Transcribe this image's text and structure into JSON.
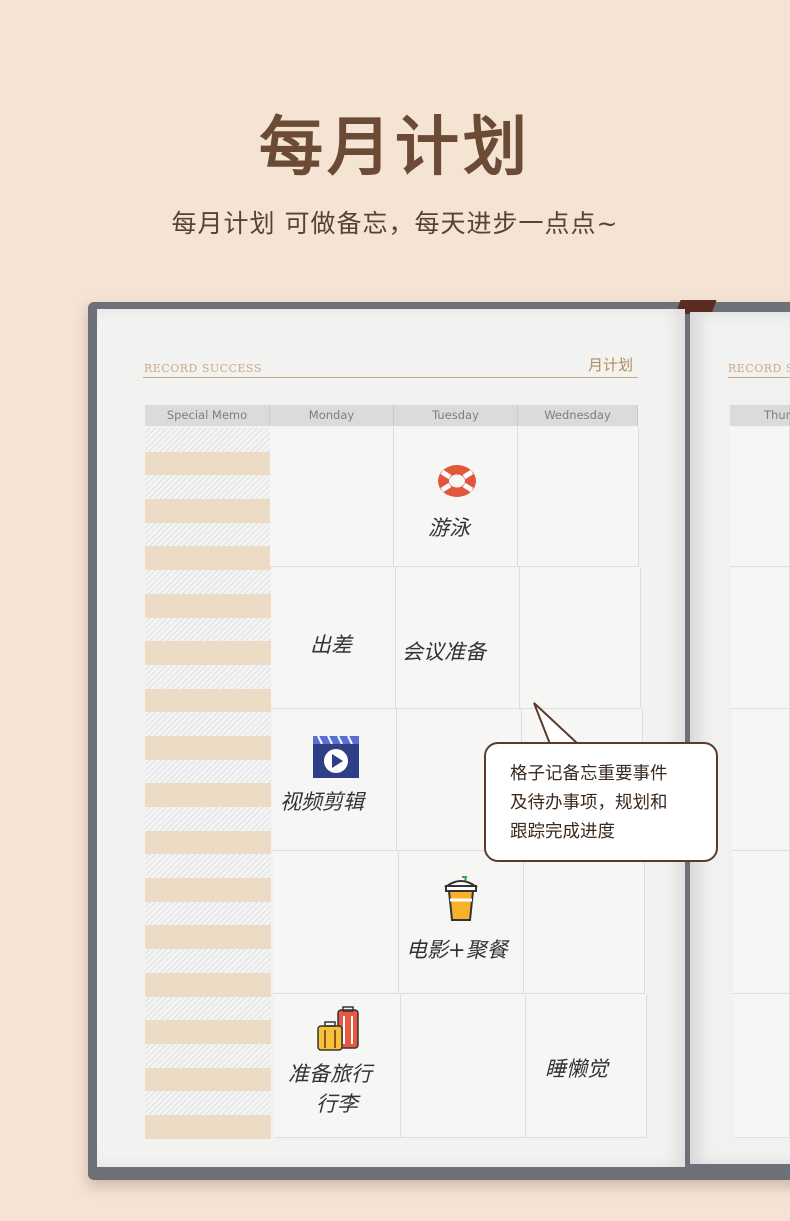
{
  "header": {
    "title": "每月计划",
    "subtitle": "每月计划 可做备忘，每天进步一点点~"
  },
  "notebook": {
    "brand_left": "RECORD SUCCESS",
    "brand_right": "RECORD S",
    "month_label": "月计划",
    "columns": [
      "Special Memo",
      "Monday",
      "Tuesday",
      "Wednesday"
    ],
    "right_page_column": "Thur",
    "notes": {
      "swim": "游泳",
      "business_trip": "出差",
      "meeting_prep": "会议准备",
      "video_edit": "视频剪辑",
      "movie_dinner": "电影+聚餐",
      "travel_pack_line1": "准备旅行",
      "travel_pack_line2": "行李",
      "sleep_in": "睡懒觉"
    },
    "callout_lines": [
      "格子记备忘重要事件",
      "及待办事项，规划和",
      "跟踪完成进度"
    ]
  },
  "icons": [
    "lifebuoy-icon",
    "video-play-icon",
    "drink-cup-icon",
    "luggage-icon"
  ],
  "colors": {
    "background": "#f5e3d4",
    "title": "#6b4a36",
    "memo_tan": "#ecdcc6",
    "cover": "#6d7078",
    "callout_border": "#5b3c2c"
  }
}
